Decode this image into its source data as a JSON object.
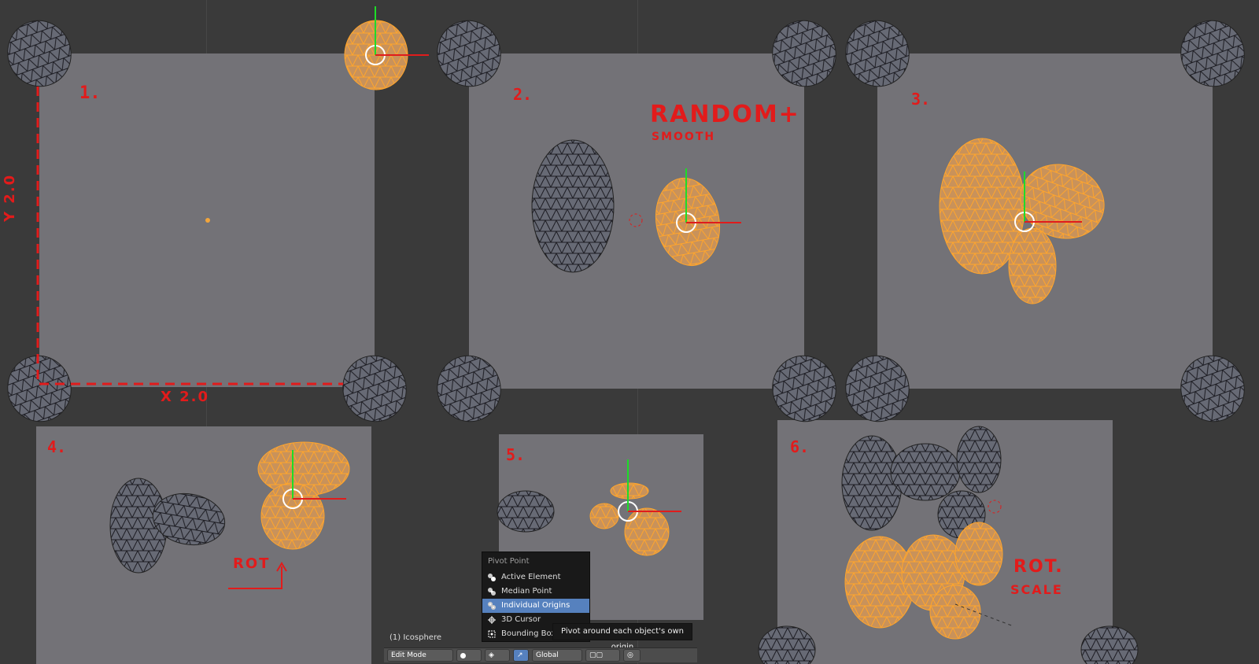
{
  "panels": [
    {
      "num": "1."
    },
    {
      "num": "2."
    },
    {
      "num": "3."
    },
    {
      "num": "4."
    },
    {
      "num": "5."
    },
    {
      "num": "6."
    }
  ],
  "annotations": {
    "random": "RANDOM+",
    "smooth": "SMOOTH",
    "rot_panel4": "ROT",
    "rot_panel6": "ROT.",
    "scale": "SCALE",
    "y_axis": "Y 2.0",
    "x_axis": "X 2.0"
  },
  "menu": {
    "title": "Pivot Point",
    "items": [
      {
        "label": "Active Element",
        "icon": "active-element-icon"
      },
      {
        "label": "Median Point",
        "icon": "median-point-icon"
      },
      {
        "label": "Individual Origins",
        "icon": "individual-origins-icon",
        "highlighted": true
      },
      {
        "label": "3D Cursor",
        "icon": "cursor-3d-icon"
      },
      {
        "label": "Bounding Box Center",
        "icon": "bounding-box-icon"
      }
    ]
  },
  "tooltip": "Pivot around each object's own origin",
  "status": {
    "object": "(1) Icosphere"
  },
  "toolbar": {
    "mode": "Edit Mode",
    "orientation": "Global"
  },
  "colors": {
    "selection": "#f5a033",
    "panel_bg": "#737277",
    "viewport_bg": "#3a3a3a",
    "annotation": "#e21b1b",
    "menu_highlight": "#5681be"
  }
}
